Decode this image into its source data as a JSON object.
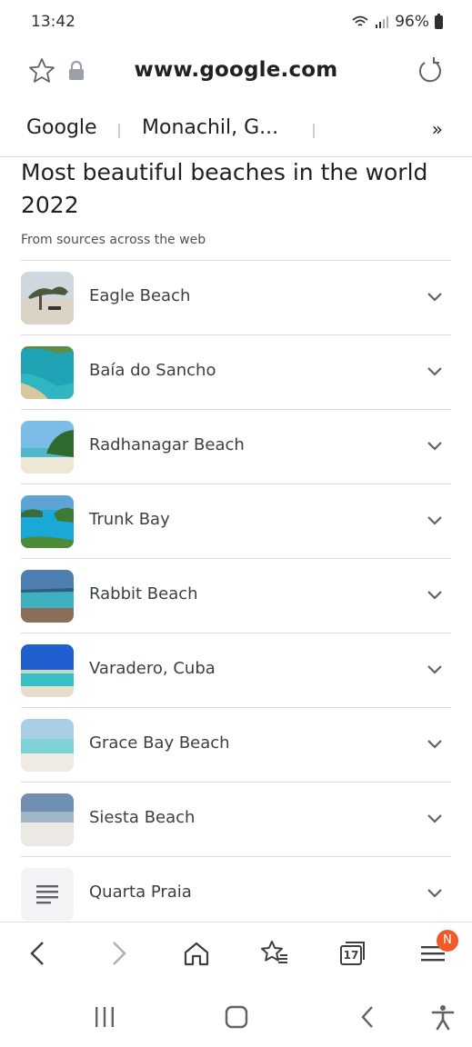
{
  "status_bar": {
    "time": "13:42",
    "battery": "96%"
  },
  "url_bar": {
    "url": "www.google.com"
  },
  "tabs": {
    "items": [
      "Google",
      "Monachil, G..."
    ],
    "more": "»"
  },
  "page": {
    "title": "Most beautiful beaches in the world 2022",
    "subtitle": "From sources across the web"
  },
  "beaches": [
    {
      "name": "Eagle Beach",
      "thumb_icon": "beach-photo"
    },
    {
      "name": "Baía do Sancho",
      "thumb_icon": "beach-photo"
    },
    {
      "name": "Radhanagar Beach",
      "thumb_icon": "beach-photo"
    },
    {
      "name": "Trunk Bay",
      "thumb_icon": "beach-photo"
    },
    {
      "name": "Rabbit Beach",
      "thumb_icon": "beach-photo"
    },
    {
      "name": "Varadero, Cuba",
      "thumb_icon": "beach-photo"
    },
    {
      "name": "Grace Bay Beach",
      "thumb_icon": "beach-photo"
    },
    {
      "name": "Siesta Beach",
      "thumb_icon": "beach-photo"
    },
    {
      "name": "Quarta Praia",
      "thumb_icon": "document-icon"
    }
  ],
  "toolbar": {
    "tabs_count": "17",
    "menu_badge": "N",
    "icons": [
      "back-icon",
      "forward-icon",
      "home-icon",
      "bookmarks-icon",
      "tabs-icon",
      "menu-icon"
    ]
  },
  "colors": {
    "badge": "#f05a28",
    "text": "#202124",
    "divider": "#dadce0"
  }
}
